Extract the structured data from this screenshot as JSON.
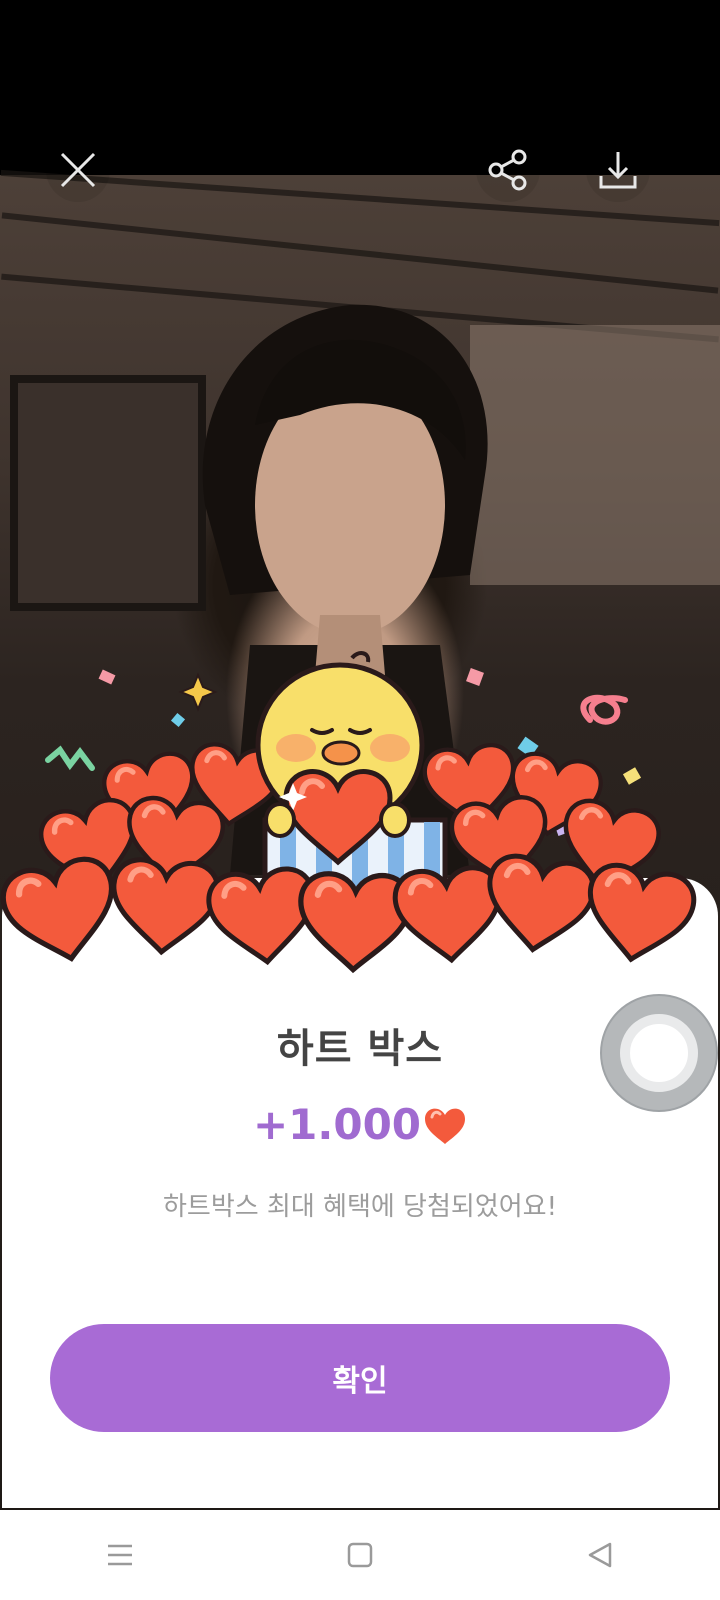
{
  "top_bar": {
    "close_icon": "close-icon",
    "share_icon": "share-icon",
    "download_icon": "download-icon"
  },
  "popup": {
    "title": "하트 박스",
    "amount": "+1.000",
    "amount_icon": "heart-icon",
    "description": "하트박스 최대 혜택에 당첨되었어요!",
    "confirm_label": "확인"
  },
  "nav": {
    "recent_icon": "menu-icon",
    "home_icon": "square-icon",
    "back_icon": "back-triangle-icon"
  },
  "colors": {
    "accent": "#a86bd5",
    "amount": "#a06bd0",
    "heart": "#f05a3c"
  }
}
